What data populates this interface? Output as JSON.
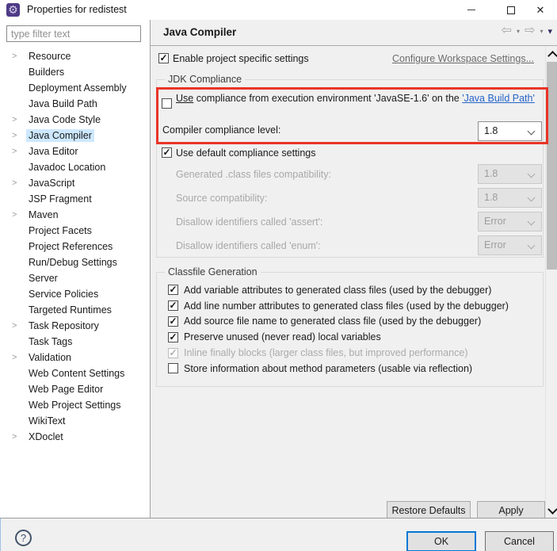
{
  "window": {
    "title": "Properties for redistest"
  },
  "icons": {
    "app": "⚙",
    "close": "✕",
    "back": "⇦",
    "forward": "⇨",
    "dropdown": "▾",
    "menu": "▾",
    "checkmark": "✓",
    "tree_chevron": ">",
    "help": "?"
  },
  "sidebar": {
    "filter_placeholder": "type filter text",
    "items": [
      {
        "label": "Resource",
        "expandable": true,
        "selected": false
      },
      {
        "label": "Builders",
        "expandable": false,
        "selected": false
      },
      {
        "label": "Deployment Assembly",
        "expandable": false,
        "selected": false
      },
      {
        "label": "Java Build Path",
        "expandable": false,
        "selected": false
      },
      {
        "label": "Java Code Style",
        "expandable": true,
        "selected": false
      },
      {
        "label": "Java Compiler",
        "expandable": true,
        "selected": true
      },
      {
        "label": "Java Editor",
        "expandable": true,
        "selected": false
      },
      {
        "label": "Javadoc Location",
        "expandable": false,
        "selected": false
      },
      {
        "label": "JavaScript",
        "expandable": true,
        "selected": false
      },
      {
        "label": "JSP Fragment",
        "expandable": false,
        "selected": false
      },
      {
        "label": "Maven",
        "expandable": true,
        "selected": false
      },
      {
        "label": "Project Facets",
        "expandable": false,
        "selected": false
      },
      {
        "label": "Project References",
        "expandable": false,
        "selected": false
      },
      {
        "label": "Run/Debug Settings",
        "expandable": false,
        "selected": false
      },
      {
        "label": "Server",
        "expandable": false,
        "selected": false
      },
      {
        "label": "Service Policies",
        "expandable": false,
        "selected": false
      },
      {
        "label": "Targeted Runtimes",
        "expandable": false,
        "selected": false
      },
      {
        "label": "Task Repository",
        "expandable": true,
        "selected": false
      },
      {
        "label": "Task Tags",
        "expandable": false,
        "selected": false
      },
      {
        "label": "Validation",
        "expandable": true,
        "selected": false
      },
      {
        "label": "Web Content Settings",
        "expandable": false,
        "selected": false
      },
      {
        "label": "Web Page Editor",
        "expandable": false,
        "selected": false
      },
      {
        "label": "Web Project Settings",
        "expandable": false,
        "selected": false
      },
      {
        "label": "WikiText",
        "expandable": false,
        "selected": false
      },
      {
        "label": "XDoclet",
        "expandable": true,
        "selected": false
      }
    ]
  },
  "header": {
    "title": "Java Compiler"
  },
  "content": {
    "enable": {
      "label": "Enable project specific settings",
      "checked": true
    },
    "workspace_link": "Configure Workspace Settings...",
    "jdk_group": {
      "title": "JDK Compliance",
      "use_compliance": {
        "underlined": "Use",
        "rest": " compliance from execution environment 'JavaSE-1.6' on the ",
        "link": "'Java Build Path'",
        "checked": false
      },
      "compiler_level": {
        "label": "Compiler compliance level:",
        "value": "1.8"
      },
      "use_default": {
        "label": "Use default compliance settings",
        "checked": true
      },
      "rows": [
        {
          "label": "Generated .class files compatibility:",
          "value": "1.8"
        },
        {
          "label": "Source compatibility:",
          "value": "1.8"
        },
        {
          "label": "Disallow identifiers called 'assert':",
          "value": "Error"
        },
        {
          "label": "Disallow identifiers called 'enum':",
          "value": "Error"
        }
      ]
    },
    "classfile_group": {
      "title": "Classfile Generation",
      "options": [
        {
          "label": "Add variable attributes to generated class files (used by the debugger)",
          "checked": true,
          "disabled": false
        },
        {
          "label": "Add line number attributes to generated class files (used by the debugger)",
          "checked": true,
          "disabled": false
        },
        {
          "label": "Add source file name to generated class file (used by the debugger)",
          "checked": true,
          "disabled": false
        },
        {
          "label": "Preserve unused (never read) local variables",
          "checked": true,
          "disabled": false
        },
        {
          "label": "Inline finally blocks (larger class files, but improved performance)",
          "checked": true,
          "disabled": true
        },
        {
          "label": "Store information about method parameters (usable via reflection)",
          "checked": false,
          "disabled": false
        }
      ]
    },
    "buttons": {
      "restore": "Restore Defaults",
      "apply": "Apply"
    }
  },
  "footer": {
    "ok": "OK",
    "cancel": "Cancel"
  },
  "colors": {
    "annotation_red": "#e93428",
    "selection_blue": "#cde8ff",
    "link_blue": "#2563c9",
    "accent_blue": "#0078d7"
  }
}
